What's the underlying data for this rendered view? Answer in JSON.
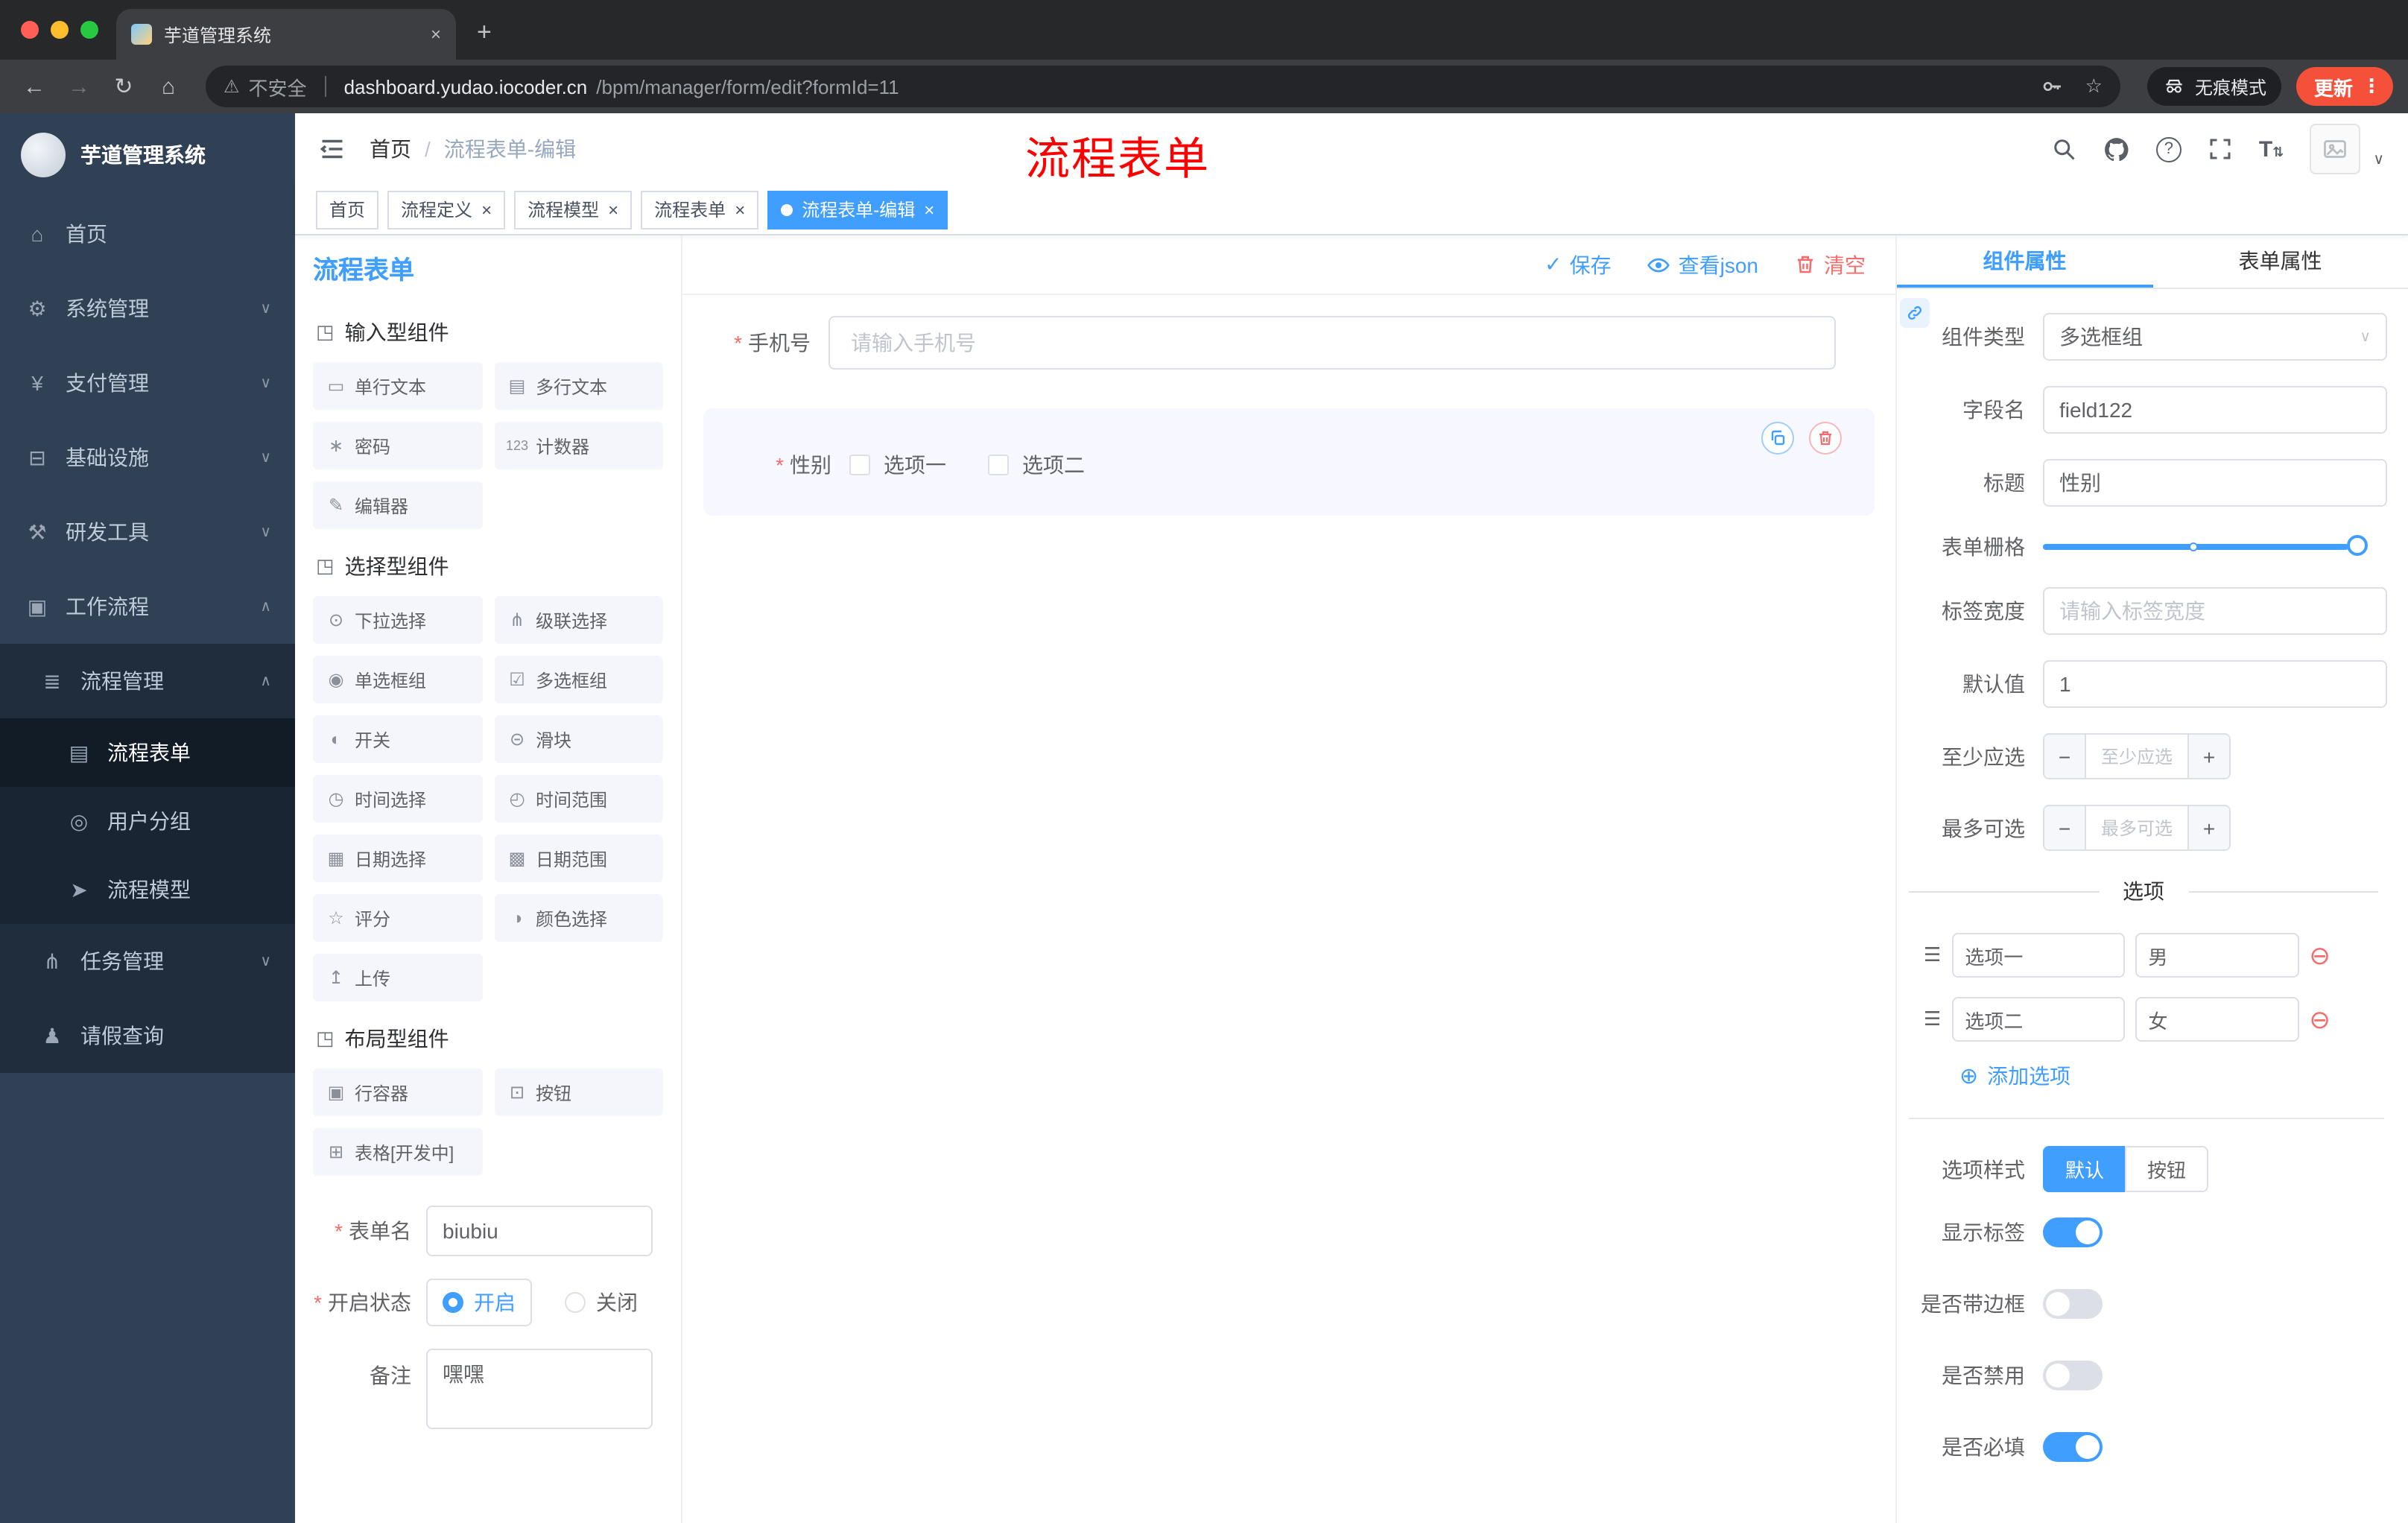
{
  "browser": {
    "tab_title": "芋道管理系统",
    "security_label": "不安全",
    "url_domain": "dashboard.yudao.iocoder.cn",
    "url_path": "/bpm/manager/form/edit?formId=11",
    "incognito_label": "无痕模式",
    "update_label": "更新"
  },
  "sidebar": {
    "app_title": "芋道管理系统",
    "items": [
      {
        "icon": "⌂",
        "label": "首页",
        "chevron": ""
      },
      {
        "icon": "⚙",
        "label": "系统管理",
        "chevron": "∨"
      },
      {
        "icon": "¥",
        "label": "支付管理",
        "chevron": "∨"
      },
      {
        "icon": "⊟",
        "label": "基础设施",
        "chevron": "∨"
      },
      {
        "icon": "⚒",
        "label": "研发工具",
        "chevron": "∨"
      },
      {
        "icon": "▣",
        "label": "工作流程",
        "chevron": "∧"
      }
    ],
    "sub_items": [
      {
        "icon": "≣",
        "label": "流程管理",
        "chevron": "∧"
      }
    ],
    "leaf_items": [
      {
        "icon": "▤",
        "label": "流程表单"
      },
      {
        "icon": "◎",
        "label": "用户分组"
      },
      {
        "icon": "➤",
        "label": "流程模型"
      }
    ],
    "tail_items": [
      {
        "icon": "⋔",
        "label": "任务管理",
        "chevron": "∨"
      },
      {
        "icon": "♟",
        "label": "请假查询",
        "chevron": ""
      }
    ]
  },
  "header": {
    "breadcrumb_home": "首页",
    "breadcrumb_sep": "/",
    "breadcrumb_current": "流程表单-编辑",
    "annotation": "流程表单"
  },
  "tags": [
    {
      "label": "首页"
    },
    {
      "label": "流程定义"
    },
    {
      "label": "流程模型"
    },
    {
      "label": "流程表单"
    },
    {
      "label": "流程表单-编辑"
    }
  ],
  "designer": {
    "title": "流程表单",
    "save": "保存",
    "view_json": "查看json",
    "clear": "清空",
    "groups": [
      {
        "title": "输入型组件",
        "items": [
          {
            "icon": "▭",
            "label": "单行文本"
          },
          {
            "icon": "▤",
            "label": "多行文本"
          },
          {
            "icon": "∗",
            "label": "密码"
          },
          {
            "icon": "123",
            "label": "计数器"
          },
          {
            "icon": "✎",
            "label": "编辑器"
          }
        ]
      },
      {
        "title": "选择型组件",
        "items": [
          {
            "icon": "⊙",
            "label": "下拉选择"
          },
          {
            "icon": "⋔",
            "label": "级联选择"
          },
          {
            "icon": "◉",
            "label": "单选框组"
          },
          {
            "icon": "☑",
            "label": "多选框组"
          },
          {
            "icon": "◐",
            "label": "开关"
          },
          {
            "icon": "⊝",
            "label": "滑块"
          },
          {
            "icon": "◷",
            "label": "时间选择"
          },
          {
            "icon": "◴",
            "label": "时间范围"
          },
          {
            "icon": "▦",
            "label": "日期选择"
          },
          {
            "icon": "▩",
            "label": "日期范围"
          },
          {
            "icon": "☆",
            "label": "评分"
          },
          {
            "icon": "◑",
            "label": "颜色选择"
          },
          {
            "icon": "↥",
            "label": "上传"
          }
        ]
      },
      {
        "title": "布局型组件",
        "items": [
          {
            "icon": "▣",
            "label": "行容器"
          },
          {
            "icon": "⊡",
            "label": "按钮"
          },
          {
            "icon": "⊞",
            "label": "表格[开发中]"
          }
        ]
      }
    ],
    "meta": {
      "form_name_label": "表单名",
      "form_name_value": "biubiu",
      "status_label": "开启状态",
      "status_on": "开启",
      "status_off": "关闭",
      "remark_label": "备注",
      "remark_value": "嘿嘿"
    },
    "canvas": {
      "phone_label": "手机号",
      "phone_placeholder": "请输入手机号",
      "gender_label": "性别",
      "gender_option1": "选项一",
      "gender_option2": "选项二"
    }
  },
  "panel": {
    "tab_component": "组件属性",
    "tab_form": "表单属性",
    "type_label": "组件类型",
    "type_value": "多选框组",
    "field_label": "字段名",
    "field_value": "field122",
    "title_label": "标题",
    "title_value": "性别",
    "grid_label": "表单栅格",
    "width_label": "标签宽度",
    "width_placeholder": "请输入标签宽度",
    "default_label": "默认值",
    "default_value": "1",
    "min_label": "至少应选",
    "min_placeholder": "至少应选",
    "max_label": "最多可选",
    "max_placeholder": "最多可选",
    "options_title": "选项",
    "options": [
      {
        "label": "选项一",
        "value": "男"
      },
      {
        "label": "选项二",
        "value": "女"
      }
    ],
    "add_option": "添加选项",
    "style_label": "选项样式",
    "style_default": "默认",
    "style_button": "按钮",
    "switches": [
      {
        "label": "显示标签",
        "on": true
      },
      {
        "label": "是否带边框",
        "on": false
      },
      {
        "label": "是否禁用",
        "on": false
      },
      {
        "label": "是否必填",
        "on": true
      }
    ]
  }
}
